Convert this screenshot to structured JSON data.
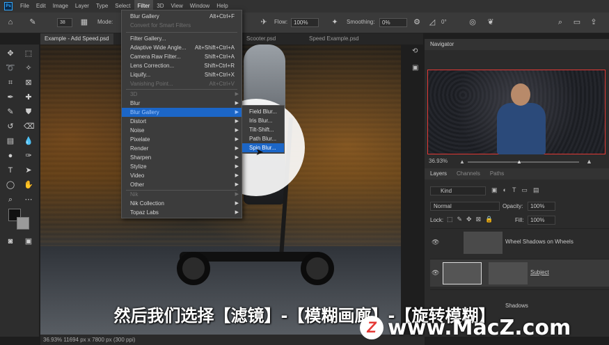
{
  "menubar": {
    "items": [
      "File",
      "Edit",
      "Image",
      "Layer",
      "Type",
      "Select",
      "Filter",
      "3D",
      "View",
      "Window",
      "Help"
    ],
    "active": "Filter"
  },
  "options": {
    "mode_label": "Mode:",
    "brush_size": "38",
    "flow_label": "Flow:",
    "flow_value": "100%",
    "smoothing_label": "Smoothing:",
    "smoothing_value": "0%",
    "angle_value": "0°"
  },
  "tabs": [
    "Example - Add Speed.psd",
    "Scooter.psd",
    "Speed Example.psd"
  ],
  "filter_menu": [
    {
      "label": "Blur Gallery",
      "shortcut": "Alt+Ctrl+F",
      "state": "normal"
    },
    {
      "label": "Convert for Smart Filters",
      "shortcut": "",
      "state": "disabled"
    },
    {
      "label": "Filter Gallery...",
      "shortcut": "",
      "state": "normal"
    },
    {
      "label": "Adaptive Wide Angle...",
      "shortcut": "Alt+Shift+Ctrl+A",
      "state": "normal"
    },
    {
      "label": "Camera Raw Filter...",
      "shortcut": "Shift+Ctrl+A",
      "state": "normal"
    },
    {
      "label": "Lens Correction...",
      "shortcut": "Shift+Ctrl+R",
      "state": "normal"
    },
    {
      "label": "Liquify...",
      "shortcut": "Shift+Ctrl+X",
      "state": "normal"
    },
    {
      "label": "Vanishing Point...",
      "shortcut": "Alt+Ctrl+V",
      "state": "disabled"
    },
    {
      "label": "3D",
      "shortcut": "",
      "state": "disabled",
      "submenu": true
    },
    {
      "label": "Blur",
      "shortcut": "",
      "state": "normal",
      "submenu": true
    },
    {
      "label": "Blur Gallery",
      "shortcut": "",
      "state": "highlighted",
      "submenu": true
    },
    {
      "label": "Distort",
      "shortcut": "",
      "state": "normal",
      "submenu": true
    },
    {
      "label": "Noise",
      "shortcut": "",
      "state": "normal",
      "submenu": true
    },
    {
      "label": "Pixelate",
      "shortcut": "",
      "state": "normal",
      "submenu": true
    },
    {
      "label": "Render",
      "shortcut": "",
      "state": "normal",
      "submenu": true
    },
    {
      "label": "Sharpen",
      "shortcut": "",
      "state": "normal",
      "submenu": true
    },
    {
      "label": "Stylize",
      "shortcut": "",
      "state": "normal",
      "submenu": true
    },
    {
      "label": "Video",
      "shortcut": "",
      "state": "normal",
      "submenu": true
    },
    {
      "label": "Other",
      "shortcut": "",
      "state": "normal",
      "submenu": true
    },
    {
      "label": "Nik",
      "shortcut": "",
      "state": "disabled",
      "submenu": true
    },
    {
      "label": "Nik Collection",
      "shortcut": "",
      "state": "normal",
      "submenu": true
    },
    {
      "label": "Topaz Labs",
      "shortcut": "",
      "state": "normal",
      "submenu": true
    }
  ],
  "blur_gallery_submenu": [
    {
      "label": "Field Blur...",
      "state": "normal"
    },
    {
      "label": "Iris Blur...",
      "state": "normal"
    },
    {
      "label": "Tilt-Shift...",
      "state": "normal"
    },
    {
      "label": "Path Blur...",
      "state": "normal"
    },
    {
      "label": "Spin Blur...",
      "state": "highlighted"
    }
  ],
  "navigator": {
    "title": "Navigator",
    "zoom": "36.93%"
  },
  "layers": {
    "tabs": [
      "Layers",
      "Channels",
      "Paths"
    ],
    "filter_kind": "Kind",
    "blend_mode": "Normal",
    "opacity_label": "Opacity:",
    "opacity_value": "100%",
    "lock_label": "Lock:",
    "fill_label": "Fill:",
    "fill_value": "100%",
    "items": [
      "Wheel Shadows on Wheels",
      "Subject",
      "Shadows"
    ]
  },
  "status": "36.93% 11694 px x 7800 px (300 ppi)",
  "subtitle": "然后我们选择【滤镜】-【模糊画廊】-【旋转模糊】",
  "watermark": {
    "badge": "Z",
    "text": "www.MacZ.com"
  },
  "colors": {
    "highlight": "#1c66c7",
    "menu_bg": "#3c3c3c",
    "accent_red": "#e53935",
    "ps_blue": "#31a8ff"
  }
}
